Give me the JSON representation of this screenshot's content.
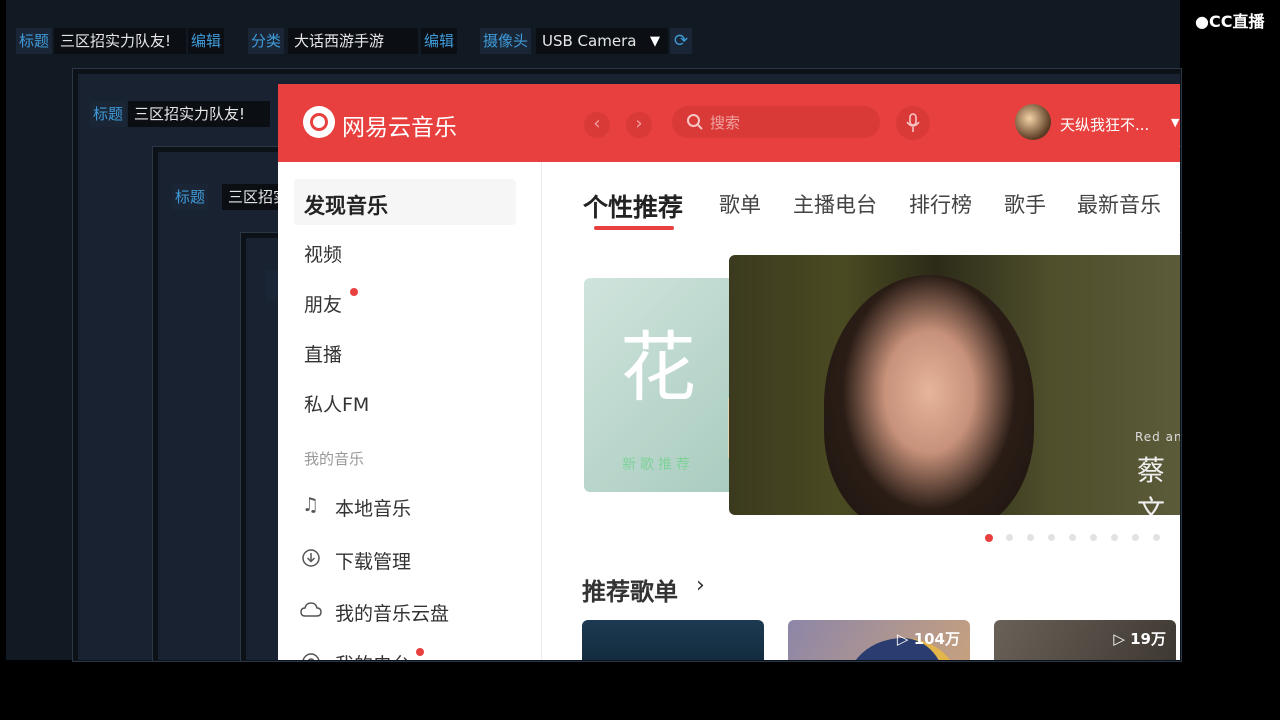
{
  "toolbar": {
    "title_label": "标题",
    "title_value": "三区招实力队友!",
    "edit_label": "编辑",
    "category_label": "分类",
    "category_value": "大话西游手游",
    "camera_label": "摄像头",
    "camera_value": "USB Camera"
  },
  "watermark": {
    "text": "CC直播"
  },
  "netease": {
    "brand": "网易云音乐",
    "search_placeholder": "搜索",
    "user_name": "天纵我狂不...",
    "sidebar": {
      "discover": "发现音乐",
      "video": "视频",
      "friends": "朋友",
      "live": "直播",
      "private_fm": "私人FM",
      "my_music_header": "我的音乐",
      "local_music": "本地音乐",
      "downloads": "下载管理",
      "cloud": "我的音乐云盘",
      "radio": "我的电台"
    },
    "tabs": [
      "个性推荐",
      "歌单",
      "主播电台",
      "排行榜",
      "歌手",
      "最新音乐"
    ],
    "banner": {
      "left_text": "花",
      "left_caption": "新歌推荐",
      "right_small": "Red an",
      "right_name": "蔡文"
    },
    "section_title": "推荐歌单",
    "playlists": [
      {
        "count": ""
      },
      {
        "count": "104万"
      },
      {
        "count": "19万"
      }
    ]
  },
  "colors": {
    "accent": "#e7403e",
    "tool_bg": "#111923",
    "tool_link": "#3f9ad8"
  }
}
